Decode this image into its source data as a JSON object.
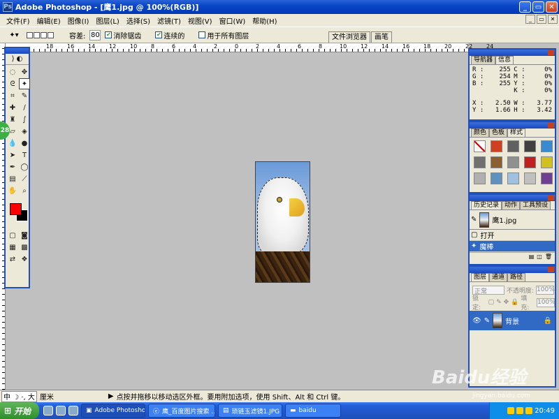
{
  "window": {
    "title": "Adobe Photoshop - [鹰1.jpg @ 100%(RGB)]",
    "minimize": "_",
    "restore": "▭",
    "close": "✕"
  },
  "menu": [
    "文件(F)",
    "编辑(E)",
    "图像(I)",
    "图层(L)",
    "选择(S)",
    "滤镜(T)",
    "视图(V)",
    "窗口(W)",
    "帮助(H)"
  ],
  "options": {
    "tolerance_label": "容差:",
    "tolerance_value": "80",
    "antialias_label": "消除锯齿",
    "contiguous_label": "连续的",
    "all_layers_label": "用于所有图层",
    "tabs": [
      "文件浏览器",
      "画笔"
    ]
  },
  "ruler": {
    "h_ticks": [
      "18",
      "16",
      "14",
      "12",
      "10",
      "8",
      "6",
      "4",
      "2",
      "0",
      "2",
      "4",
      "6",
      "8",
      "10",
      "12",
      "14",
      "16",
      "18",
      "20",
      "22",
      "24"
    ]
  },
  "toolbox": {
    "logo": "⟩ ◐"
  },
  "navigator": {
    "tabs": [
      "导航器",
      "信息"
    ],
    "rgb": {
      "R": "255",
      "G": "254",
      "B": "255"
    },
    "cmyk": {
      "C": "0%",
      "M": "0%",
      "Y": "0%",
      "K": "0%"
    },
    "xy": {
      "X": "2.50",
      "Y": "1.66"
    },
    "wh": {
      "W": "3.77",
      "H": "3.42"
    }
  },
  "styles": {
    "tabs": [
      "颜色",
      "色板",
      "样式"
    ],
    "swatch_colors": [
      "#ffffff",
      "#d04020",
      "#606060",
      "#404040",
      "#3a8ad0",
      "#707070",
      "#8a6030",
      "#909090",
      "#c02020",
      "#d0c020",
      "#b0b0b0",
      "#6090c0",
      "#a0c0e0",
      "#c0c0c0",
      "#704090"
    ]
  },
  "history": {
    "tabs": [
      "历史记录",
      "动作",
      "工具预设"
    ],
    "snapshot": "鹰1.jpg",
    "items": [
      "打开",
      "魔棒"
    ]
  },
  "layers": {
    "tabs": [
      "图层",
      "通道",
      "路径"
    ],
    "blend_mode": "正常",
    "opacity_label": "不透明度:",
    "opacity_value": "100%",
    "lock_label": "锁定:",
    "fill_label": "填充:",
    "fill_value": "100%",
    "layer_name": "背景"
  },
  "status": {
    "ime": "中 ☽ ·, 大",
    "unit": "厘米",
    "message": "点按并拖移以移动选区外框。要用附加选项，使用 Shift、Alt 和 Ctrl 键。"
  },
  "taskbar": {
    "start": "开始",
    "tasks": [
      "Adobe Photoshop ...",
      "鹰_百度图片搜索 ...",
      "琐链玉滤镜1.JPG ...",
      "baidu"
    ],
    "clock": "20:49"
  },
  "watermark": {
    "brand": "Baidu经验",
    "url": "jingyan.baidu.com"
  },
  "badge": "28"
}
